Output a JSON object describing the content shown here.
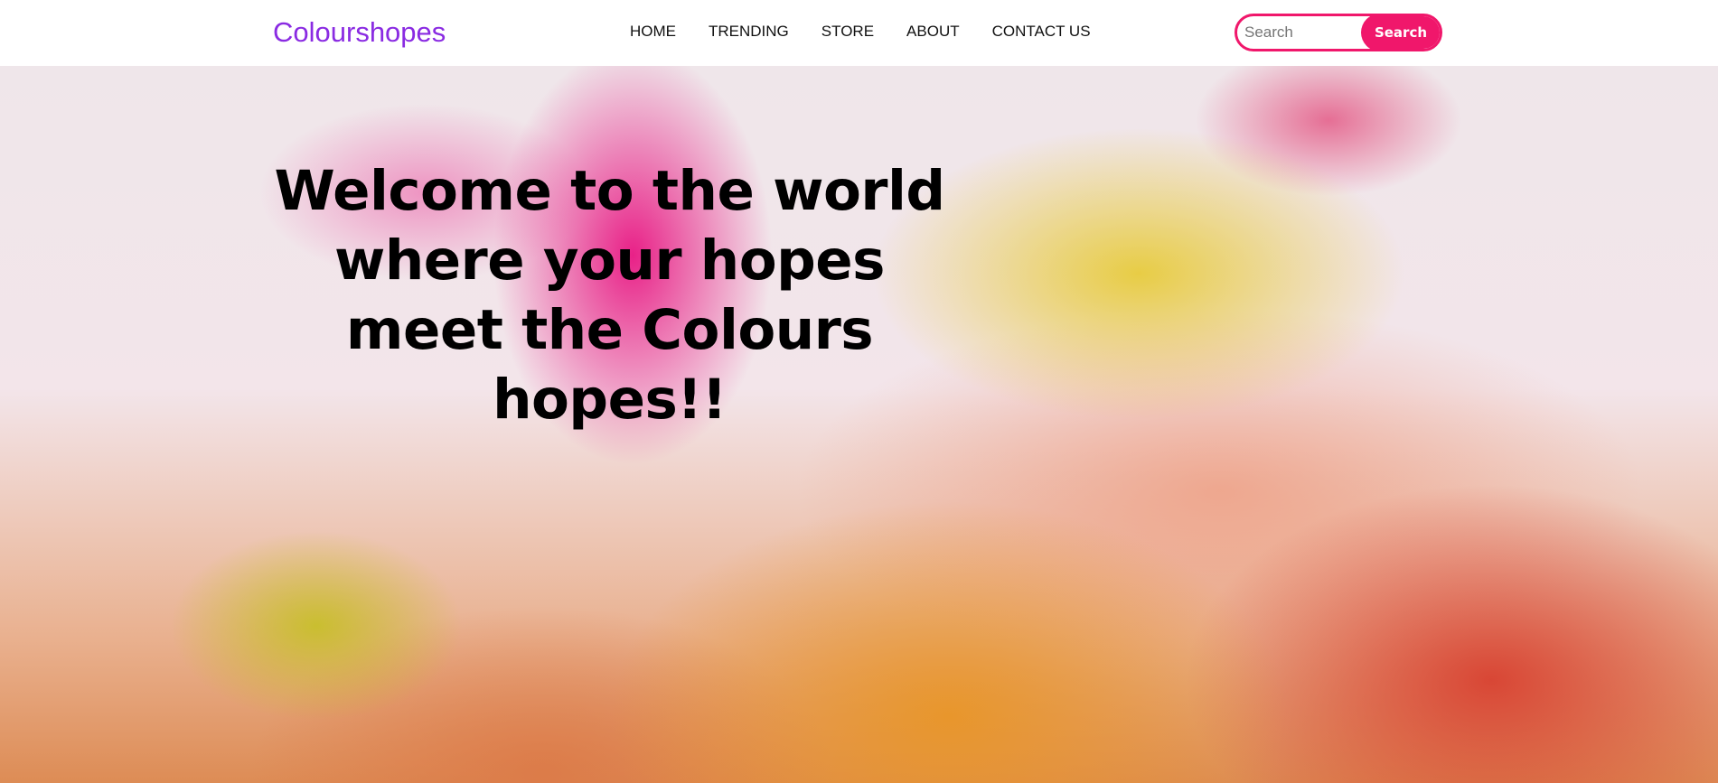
{
  "navbar": {
    "brand": "Colourshopes",
    "links": [
      "HOME",
      "TRENDING",
      "STORE",
      "ABOUT",
      "CONTACT US"
    ],
    "search": {
      "placeholder": "Search",
      "value": "",
      "button_label": "Search"
    }
  },
  "hero": {
    "title": "Welcome to the world where your hopes meet the Colours hopes!!"
  },
  "colors": {
    "brand": "#8a2be2",
    "accent": "#f0176b"
  }
}
